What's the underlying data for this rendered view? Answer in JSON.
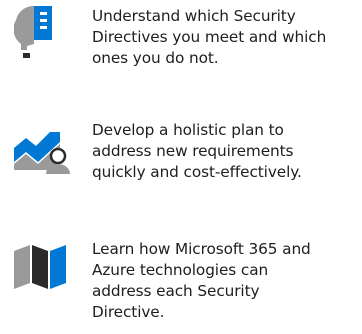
{
  "features": [
    {
      "icon": "lightbulb-checklist-icon",
      "text": "Understand which Security\nDirectives you meet and which\nones you do not."
    },
    {
      "icon": "chart-person-icon",
      "text": "Develop a holistic plan to\naddress new requirements\nquickly and cost-effectively."
    },
    {
      "icon": "map-icon",
      "text": "Learn how Microsoft 365 and\nAzure technologies can\naddress each Security\nDirective."
    }
  ],
  "colors": {
    "blue": "#0078d4",
    "gray": "#9a9a9a",
    "dark": "#2b2b2b",
    "text": "#1e1e1e"
  }
}
